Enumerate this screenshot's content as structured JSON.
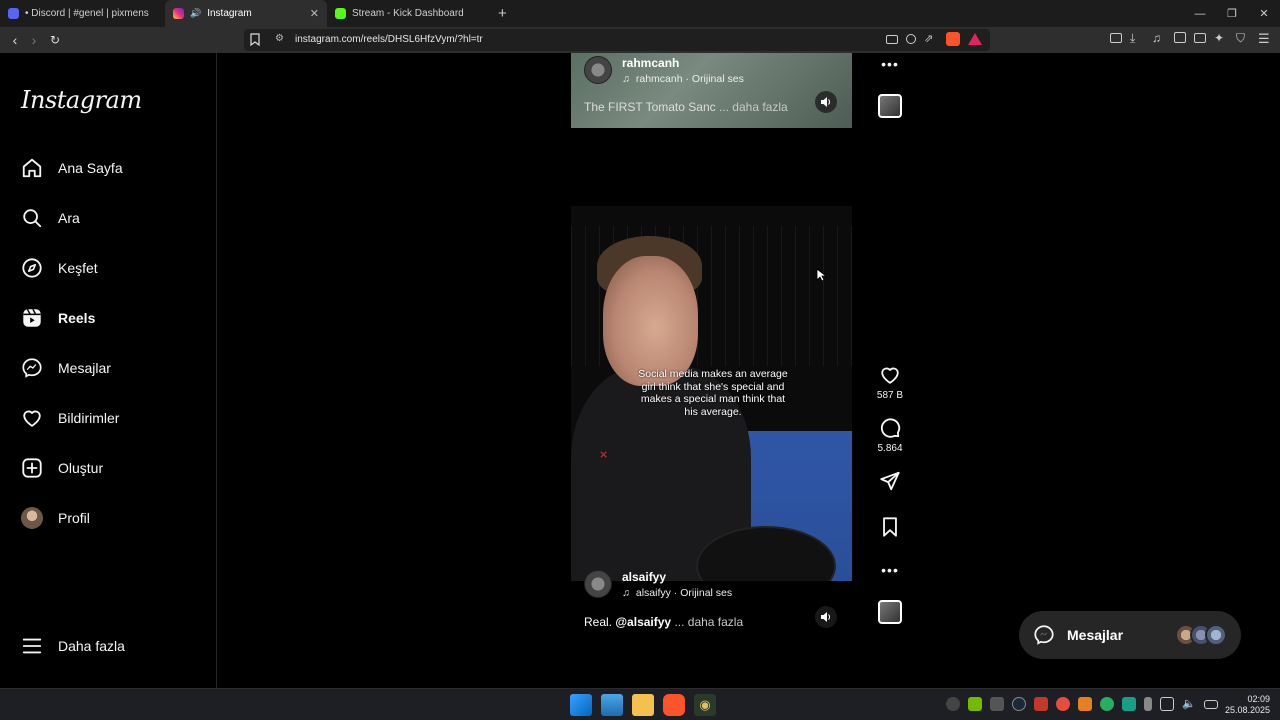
{
  "browser": {
    "tabs": [
      {
        "label": "• Discord | #genel | pixmens"
      },
      {
        "label": "Instagram"
      },
      {
        "label": "Stream - Kick Dashboard"
      }
    ],
    "url": "instagram.com/reels/DHSL6HfzVym/?hl=tr"
  },
  "sidebar": {
    "logo": "Instagram",
    "items": [
      {
        "label": "Ana Sayfa"
      },
      {
        "label": "Ara"
      },
      {
        "label": "Keşfet"
      },
      {
        "label": "Reels"
      },
      {
        "label": "Mesajlar"
      },
      {
        "label": "Bildirimler"
      },
      {
        "label": "Oluştur"
      },
      {
        "label": "Profil"
      }
    ],
    "more": "Daha fazla"
  },
  "reel1": {
    "username": "rahmcanh",
    "audio": "rahmcanh · Orijinal ses",
    "caption": "The FIRST Tomato Sanc",
    "more": "... daha fazla"
  },
  "reel2": {
    "overlay_text": "Social media makes an average girl think that she's special and makes a special man think that his average.",
    "username": "alsaifyy",
    "audio": "alsaifyy · Orijinal ses",
    "caption_prefix": "Real.",
    "caption_mention": "@alsaifyy",
    "more": "... daha fazla",
    "likes": "587 B",
    "comments": "5.864"
  },
  "messages_pill": {
    "label": "Mesajlar"
  },
  "taskbar": {
    "time": "02:09",
    "date": "25.08.2025"
  },
  "colors": {
    "bg": "#000000",
    "text": "#f5f5f5",
    "court_blue": "#2a4f99"
  }
}
